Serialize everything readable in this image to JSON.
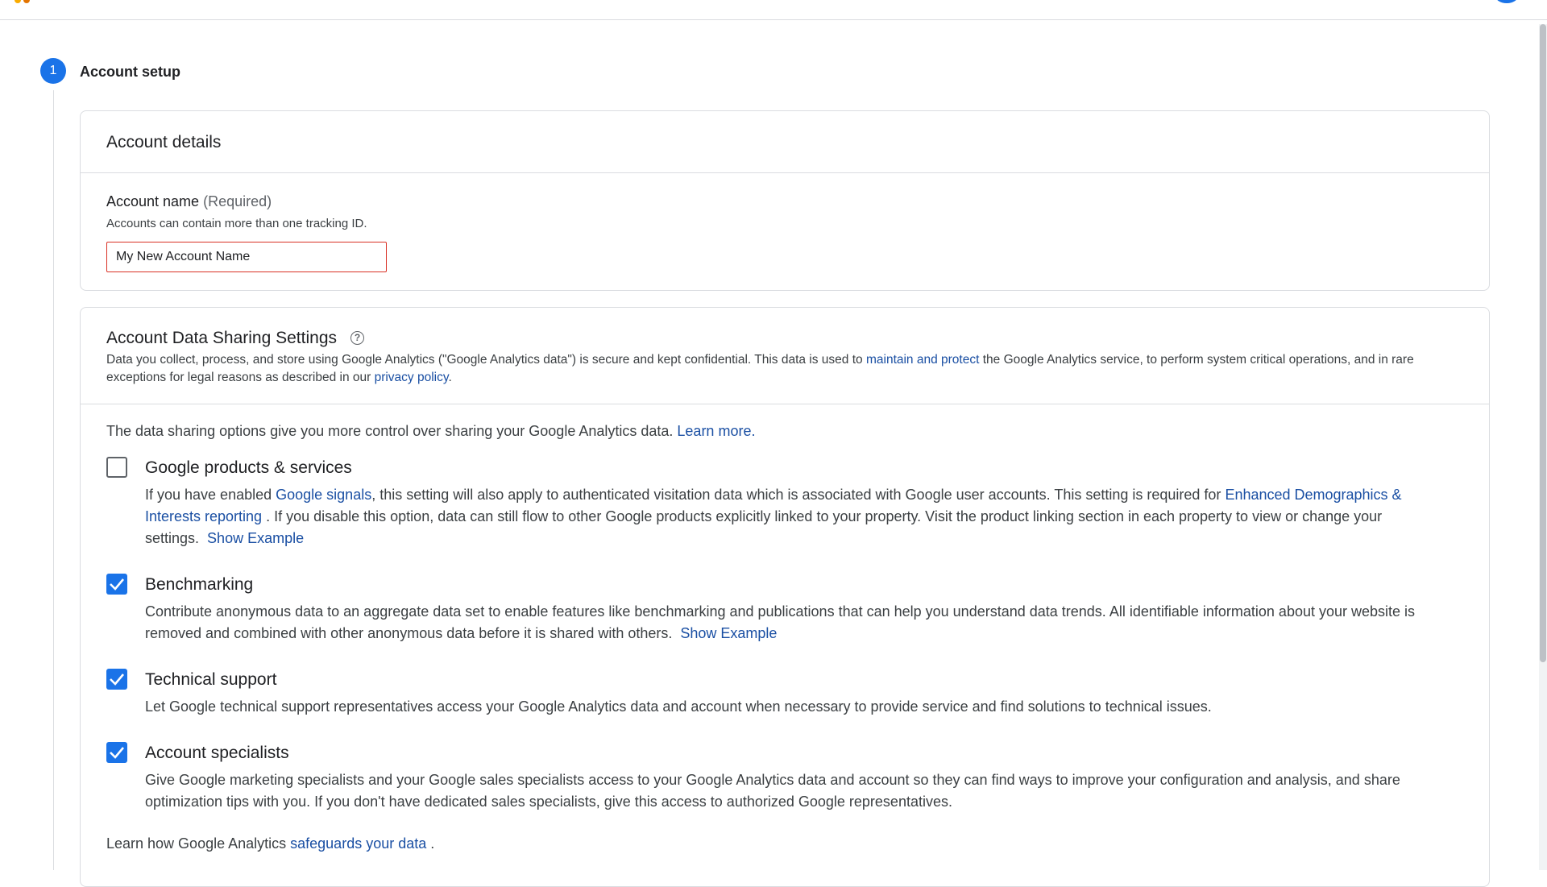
{
  "setup": {
    "step_number": "1",
    "step_title": "Account setup"
  },
  "account_details": {
    "title": "Account details",
    "name_label": "Account name",
    "name_required": "(Required)",
    "name_help": "Accounts can contain more than one tracking ID.",
    "name_input_value": "My New Account Name"
  },
  "data_sharing": {
    "title": "Account Data Sharing Settings",
    "help_icon": "help-circle-icon",
    "desc_part1": "Data you collect, process, and store using Google Analytics (\"Google Analytics data\") is secure and kept confidential. This data is used to ",
    "desc_link1": "maintain and protect",
    "desc_part2": " the Google Analytics service, to perform system critical operations, and in rare exceptions for legal reasons as described in our ",
    "desc_link2": "privacy policy",
    "desc_part3": ".",
    "intro_text": "The data sharing options give you more control over sharing your Google Analytics data. ",
    "intro_link": "Learn more.",
    "options": [
      {
        "title": "Google products & services",
        "checked": false,
        "desc_part1": "If you have enabled ",
        "desc_link1": "Google signals",
        "desc_part2": ", this setting will also apply to authenticated visitation data which is associated with Google user accounts. This setting is required for ",
        "desc_link2": "Enhanced Demographics & Interests reporting",
        "desc_part3": " . If you disable this option, data can still flow to other Google products explicitly linked to your property. Visit the product linking section in each property to view or change your settings.",
        "show_example": "Show Example"
      },
      {
        "title": "Benchmarking",
        "checked": true,
        "desc": "Contribute anonymous data to an aggregate data set to enable features like benchmarking and publications that can help you understand data trends. All identifiable information about your website is removed and combined with other anonymous data before it is shared with others.",
        "show_example": "Show Example"
      },
      {
        "title": "Technical support",
        "checked": true,
        "desc": "Let Google technical support representatives access your Google Analytics data and account when necessary to provide service and find solutions to technical issues."
      },
      {
        "title": "Account specialists",
        "checked": true,
        "desc": "Give Google marketing specialists and your Google sales specialists access to your Google Analytics data and account so they can find ways to improve your configuration and analysis, and share optimization tips with you. If you don't have dedicated sales specialists, give this access to authorized Google representatives."
      }
    ],
    "footer_text": "Learn how Google Analytics ",
    "footer_link": "safeguards your data",
    "footer_end": " ."
  },
  "colors": {
    "accent": "#1a73e8",
    "link": "#1a4fa3",
    "error": "#d93025"
  }
}
